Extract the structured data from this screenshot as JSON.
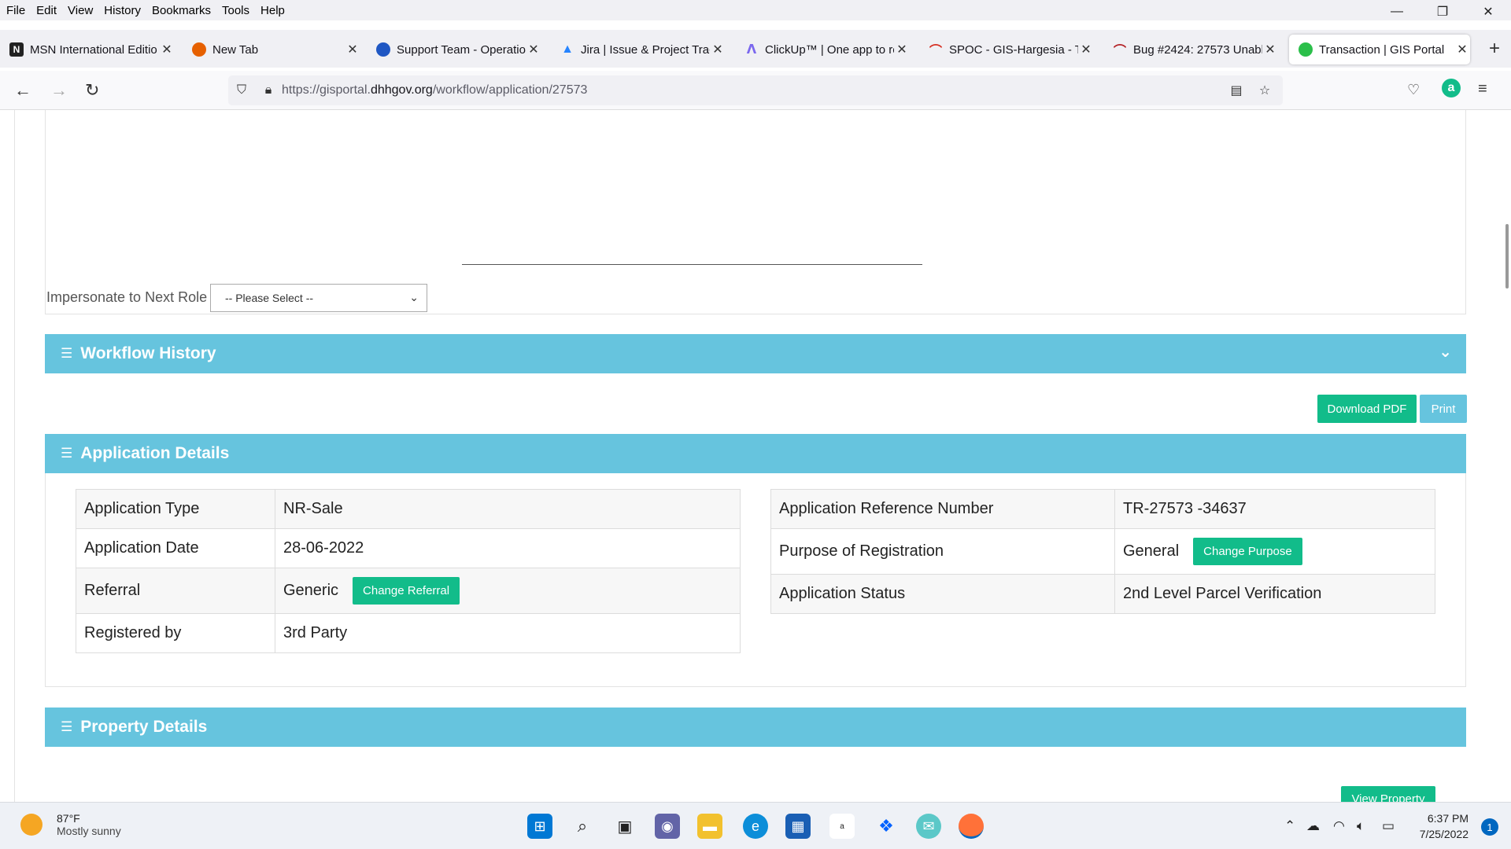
{
  "menu": [
    "File",
    "Edit",
    "View",
    "History",
    "Bookmarks",
    "Tools",
    "Help"
  ],
  "window_controls": {
    "minimize": "—",
    "restore": "❐",
    "close": "✕"
  },
  "tabs": [
    {
      "title": "MSN International Editio",
      "icon": "msn-icon",
      "color": "#222222"
    },
    {
      "title": "New Tab",
      "icon": "firefox-icon",
      "color": "#e66000"
    },
    {
      "title": "Support Team - Operatio",
      "icon": "support-icon",
      "color": "#1f57c3"
    },
    {
      "title": "Jira | Issue & Project Trac",
      "icon": "jira-icon",
      "color": "#2684ff"
    },
    {
      "title": "ClickUp™ | One app to re",
      "icon": "clickup-icon",
      "color": "#7b68ee"
    },
    {
      "title": "SPOC - GIS-Hargesia - Te",
      "icon": "spoc-icon",
      "color": "#d62d20"
    },
    {
      "title": "Bug #2424: 27573 Unabl",
      "icon": "redmine-icon",
      "color": "#b32024"
    },
    {
      "title": "Transaction | GIS Portal",
      "icon": "gis-portal-icon",
      "color": "#2bbf4a"
    }
  ],
  "close_glyph": "✕",
  "new_tab_glyph": "+",
  "nav": {
    "back": "←",
    "forward": "→",
    "reload": "↻"
  },
  "url": {
    "prefix": "https://gisportal.",
    "domain": "dhhgov.org",
    "path": "/workflow/application/27573"
  },
  "impersonate": {
    "label": "Impersonate to Next Role",
    "selected": "-- Please Select --"
  },
  "sections": {
    "workflow_history": "Workflow History",
    "application_details": "Application Details",
    "property_details": "Property Details"
  },
  "buttons": {
    "download_pdf": "Download PDF",
    "print": "Print",
    "change_referral": "Change Referral",
    "change_purpose": "Change Purpose",
    "view_property": "View Property"
  },
  "app_left": [
    {
      "label": "Application Type",
      "value": "NR-Sale"
    },
    {
      "label": "Application Date",
      "value": "28-06-2022"
    },
    {
      "label": "Referral",
      "value": "Generic"
    },
    {
      "label": "Registered by",
      "value": "3rd Party"
    }
  ],
  "app_right": [
    {
      "label": "Application Reference Number",
      "value": "TR-27573 -34637"
    },
    {
      "label": "Purpose of Registration",
      "value": "General"
    },
    {
      "label": "Application Status",
      "value": "2nd Level Parcel Verification"
    }
  ],
  "taskbar": {
    "weather_temp": "87°F",
    "weather_desc": "Mostly sunny",
    "time": "6:37 PM",
    "date": "7/25/2022",
    "notifications": "1"
  }
}
